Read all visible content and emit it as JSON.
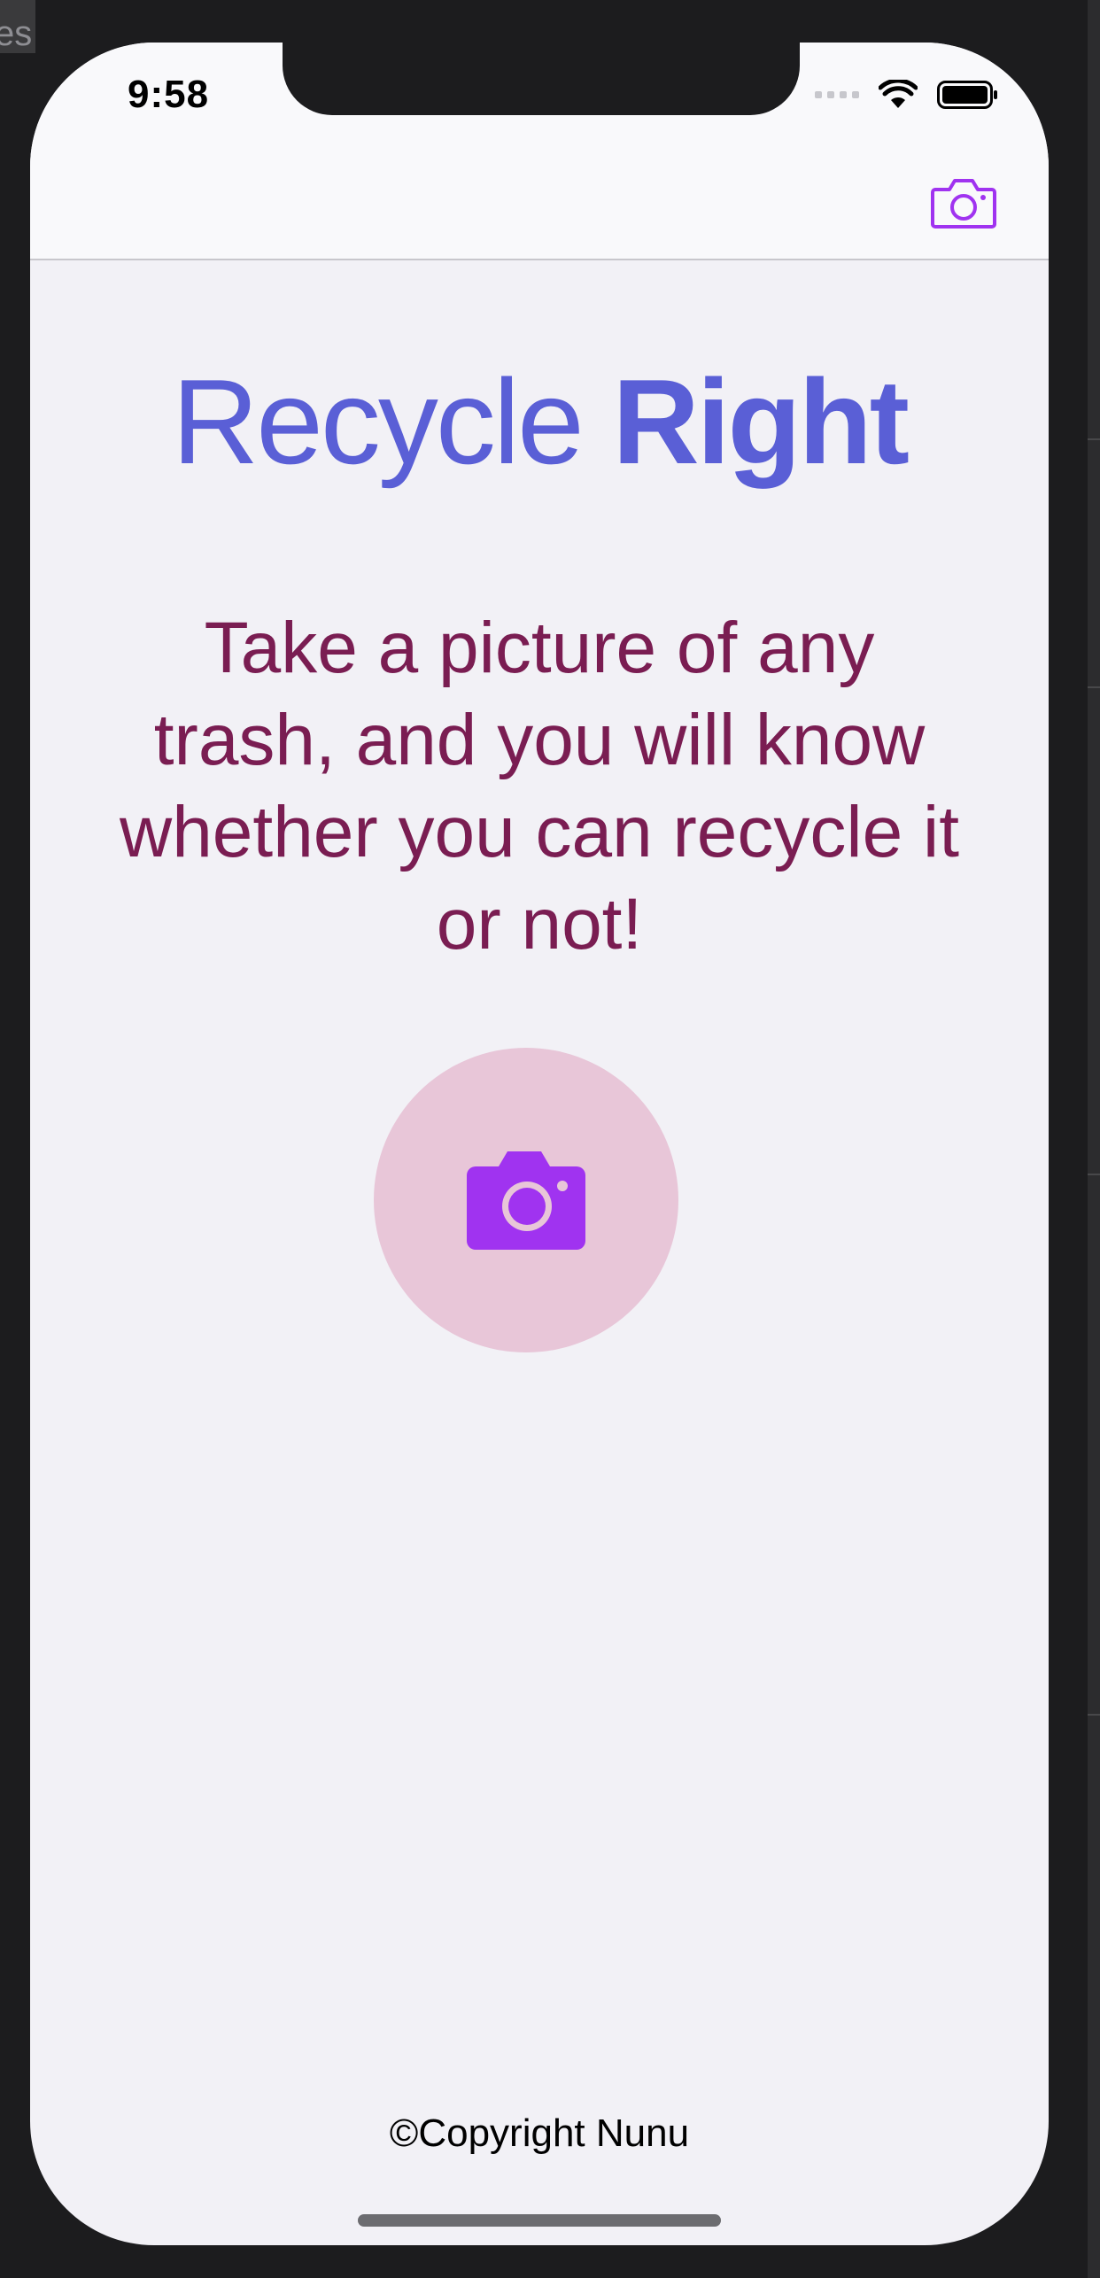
{
  "status_bar": {
    "time": "9:58"
  },
  "nav_bar": {
    "camera_icon": "camera-outline-icon"
  },
  "main": {
    "title_regular": "Recycle",
    "title_bold": "Right",
    "subtitle": "Take a picture of any trash, and you will know whether you can recycle it or not!",
    "camera_button_icon": "camera-filled-icon"
  },
  "footer": {
    "copyright": "©Copyright Nunu"
  },
  "colors": {
    "title": "#5a5fd6",
    "subtitle": "#7a1d52",
    "accent": "#a033f0",
    "camera_circle": "#e8c6d8",
    "background": "#f2f1f6"
  }
}
